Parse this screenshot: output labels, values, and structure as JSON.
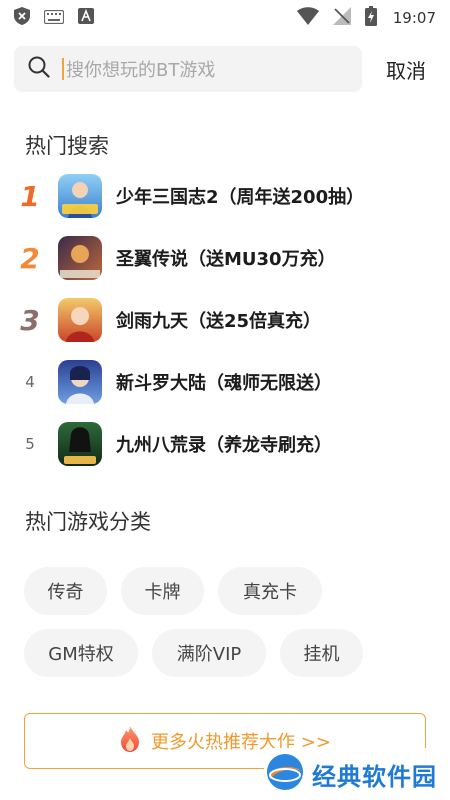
{
  "status_bar": {
    "time": "19:07",
    "icons": [
      "shield-icon",
      "keyboard-icon",
      "a-badge-icon",
      "wifi-icon",
      "no-signal-icon",
      "battery-charging-icon"
    ]
  },
  "search": {
    "placeholder": "搜你想玩的BT游戏",
    "cancel_label": "取消"
  },
  "hot_search": {
    "title": "热门搜索",
    "items": [
      {
        "rank": "1",
        "label": "少年三国志2（周年送200抽）",
        "rank_color": "#f06a2a"
      },
      {
        "rank": "2",
        "label": "圣翼传说（送MU30万充）",
        "rank_color": "#f08a3a"
      },
      {
        "rank": "3",
        "label": "剑雨九天（送25倍真充）",
        "rank_color": "#8a6f6a"
      },
      {
        "rank": "4",
        "label": "新斗罗大陆（魂师无限送）",
        "rank_color": "#666666"
      },
      {
        "rank": "5",
        "label": "九州八荒录（养龙寺刷充）",
        "rank_color": "#666666"
      }
    ]
  },
  "categories": {
    "title": "热门游戏分类",
    "tags": [
      "传奇",
      "卡牌",
      "真充卡",
      "GM特权",
      "满阶VIP",
      "挂机"
    ]
  },
  "more_button": {
    "label": "更多火热推荐大作 >>",
    "accent": "#f19a2b"
  },
  "watermark": {
    "text": "经典软件园"
  }
}
